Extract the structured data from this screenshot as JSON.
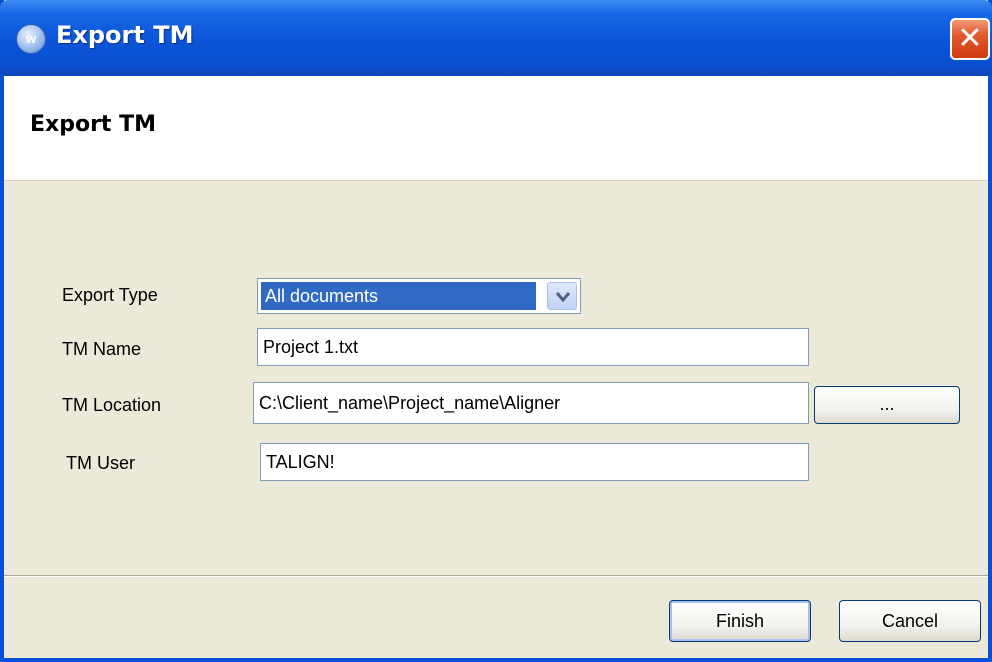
{
  "window": {
    "title": "Export TM",
    "close_glyph": "✕"
  },
  "header": {
    "title": "Export TM"
  },
  "form": {
    "export_type": {
      "label": "Export Type",
      "selected": "All documents"
    },
    "tm_name": {
      "label": "TM Name",
      "value": "Project 1.txt"
    },
    "tm_location": {
      "label": "TM Location",
      "value": "C:\\Client_name\\Project_name\\Aligner",
      "browse_label": "..."
    },
    "tm_user": {
      "label": "TM User",
      "value": "TALIGN!"
    }
  },
  "buttons": {
    "finish": "Finish",
    "cancel": "Cancel"
  },
  "icons": {
    "app": "app-logo-icon",
    "close": "close-icon",
    "dropdown": "chevron-down-icon"
  },
  "colors": {
    "titlebar": "#0a4fd0",
    "dialog_bg": "#ece9d8",
    "selection": "#316ac5",
    "close_button": "#e2582d"
  }
}
